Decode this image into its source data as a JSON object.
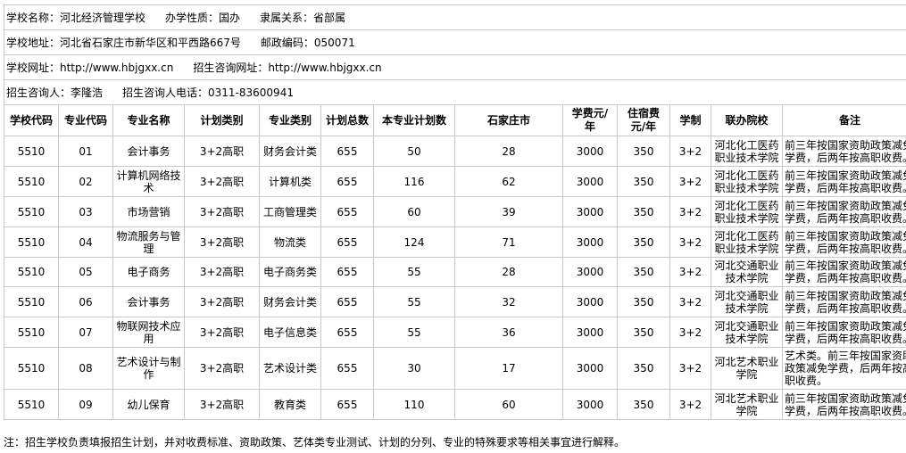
{
  "info": {
    "school_name": "学校名称：河北经济管理学校",
    "school_type": "办学性质：国办",
    "affiliation": "隶属关系：省部属",
    "address": "学校地址：河北省石家庄市新华区和平西路667号",
    "postcode": "邮政编码：050071",
    "website": "学校网址：http://www.hbjgxx.cn",
    "admission_website": "招生咨询网址：http://www.hbjgxx.cn",
    "contact": "招生咨询人：李隆浩",
    "contact_phone": "招生咨询人电话：0311-83600941"
  },
  "headers": [
    "学校代码",
    "专业代码",
    "专业名称",
    "计划类别",
    "专业类别",
    "计划总数",
    "本专业计划数",
    "石家庄市",
    "学费元/年",
    "住宿费元/年",
    "学制",
    "联办院校",
    "备注"
  ],
  "rows": [
    [
      "5510",
      "01",
      "会计事务",
      "3+2高职",
      "财务会计类",
      "655",
      "50",
      "28",
      "3000",
      "350",
      "3+2",
      "河北化工医药职业技术学院",
      "前三年按国家资助政策减免学费，后两年按高职收费。"
    ],
    [
      "5510",
      "02",
      "计算机网络技术",
      "3+2高职",
      "计算机类",
      "655",
      "116",
      "62",
      "3000",
      "350",
      "3+2",
      "河北化工医药职业技术学院",
      "前三年按国家资助政策减免学费，后两年按高职收费。"
    ],
    [
      "5510",
      "03",
      "市场营销",
      "3+2高职",
      "工商管理类",
      "655",
      "60",
      "39",
      "3000",
      "350",
      "3+2",
      "河北化工医药职业技术学院",
      "前三年按国家资助政策减免学费，后两年按高职收费。"
    ],
    [
      "5510",
      "04",
      "物流服务与管理",
      "3+2高职",
      "物流类",
      "655",
      "124",
      "71",
      "3000",
      "350",
      "3+2",
      "河北化工医药职业技术学院",
      "前三年按国家资助政策减免学费，后两年按高职收费。"
    ],
    [
      "5510",
      "05",
      "电子商务",
      "3+2高职",
      "电子商务类",
      "655",
      "55",
      "28",
      "3000",
      "350",
      "3+2",
      "河北交通职业技术学院",
      "前三年按国家资助政策减免学费，后两年按高职收费。"
    ],
    [
      "5510",
      "06",
      "会计事务",
      "3+2高职",
      "财务会计类",
      "655",
      "55",
      "32",
      "3000",
      "350",
      "3+2",
      "河北交通职业技术学院",
      "前三年按国家资助政策减免学费，后两年按高职收费。"
    ],
    [
      "5510",
      "07",
      "物联网技术应用",
      "3+2高职",
      "电子信息类",
      "655",
      "55",
      "36",
      "3000",
      "350",
      "3+2",
      "河北交通职业技术学院",
      "前三年按国家资助政策减免学费，后两年按高职收费。"
    ],
    [
      "5510",
      "08",
      "艺术设计与制作",
      "3+2高职",
      "艺术设计类",
      "655",
      "30",
      "17",
      "3000",
      "350",
      "3+2",
      "河北艺术职业学院",
      "艺术类。前三年按国家资助政策减免学费，后两年按高职收费。"
    ],
    [
      "5510",
      "09",
      "幼儿保育",
      "3+2高职",
      "教育类",
      "655",
      "110",
      "60",
      "3000",
      "350",
      "3+2",
      "河北艺术职业学院",
      "前三年按国家资助政策减免学费，后两年按高职收费。"
    ]
  ],
  "note": "注：招生学校负责填报招生计划，并对收费标准、资助政策、艺体类专业测试、计划的分列、专业的特殊要求等相关事宜进行解释。"
}
